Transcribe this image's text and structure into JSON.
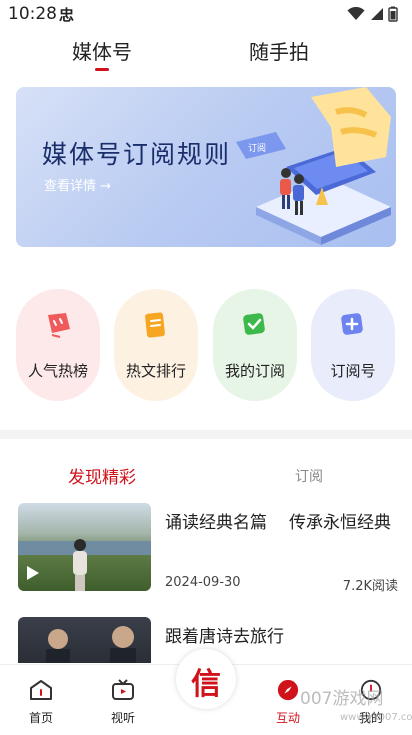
{
  "status_bar": {
    "time": "10:28",
    "notif": "忠"
  },
  "top_tabs": {
    "tab1": "媒体号",
    "tab2": "随手拍"
  },
  "banner": {
    "title": "媒体号订阅规则",
    "link": "查看详情 →",
    "art_badge": "订阅"
  },
  "entries": [
    {
      "label": "人气热榜",
      "icon": "hot-rank-icon"
    },
    {
      "label": "热文排行",
      "icon": "article-rank-icon"
    },
    {
      "label": "我的订阅",
      "icon": "my-subscription-icon"
    },
    {
      "label": "订阅号",
      "icon": "subscription-account-icon"
    }
  ],
  "feed_tabs": {
    "active": "发现精彩",
    "other": "订阅"
  },
  "articles": [
    {
      "title_part1": "诵读经典名篇",
      "title_part2": "传承永恒经典",
      "date": "2024-09-30",
      "reads": "7.2K阅读"
    },
    {
      "title": "跟着唐诗去旅行"
    }
  ],
  "bottom_nav": {
    "home": "首页",
    "video": "视听",
    "center_glyph": "信",
    "interact": "互动",
    "me": "我的"
  },
  "watermark": {
    "main": "007游戏网",
    "sub": "www.yx007.com"
  },
  "colors": {
    "accent": "#d0121b"
  }
}
